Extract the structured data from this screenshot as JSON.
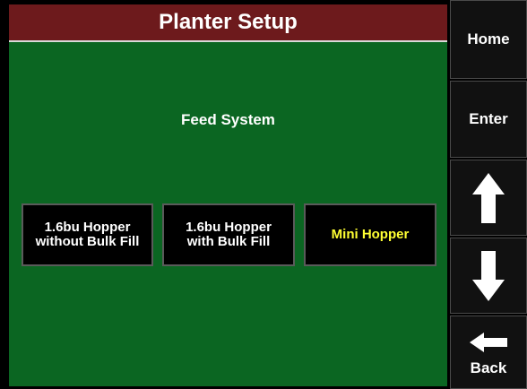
{
  "header": {
    "title": "Planter Setup"
  },
  "main": {
    "section_label": "Feed System",
    "options": [
      {
        "label": "1.6bu Hopper\nwithout Bulk Fill",
        "selected": false
      },
      {
        "label": "1.6bu Hopper\nwith Bulk Fill",
        "selected": false
      },
      {
        "label": "Mini Hopper",
        "selected": true
      }
    ]
  },
  "sidebar": {
    "home_label": "Home",
    "enter_label": "Enter",
    "up_icon": "arrow-up-icon",
    "down_icon": "arrow-down-icon",
    "back_label": "Back",
    "back_icon": "arrow-left-icon"
  },
  "colors": {
    "background": "#000000",
    "panel_green": "#0b6622",
    "title_maroon": "#6d1a1c",
    "selected_text": "#ffff33",
    "text": "#ffffff"
  }
}
